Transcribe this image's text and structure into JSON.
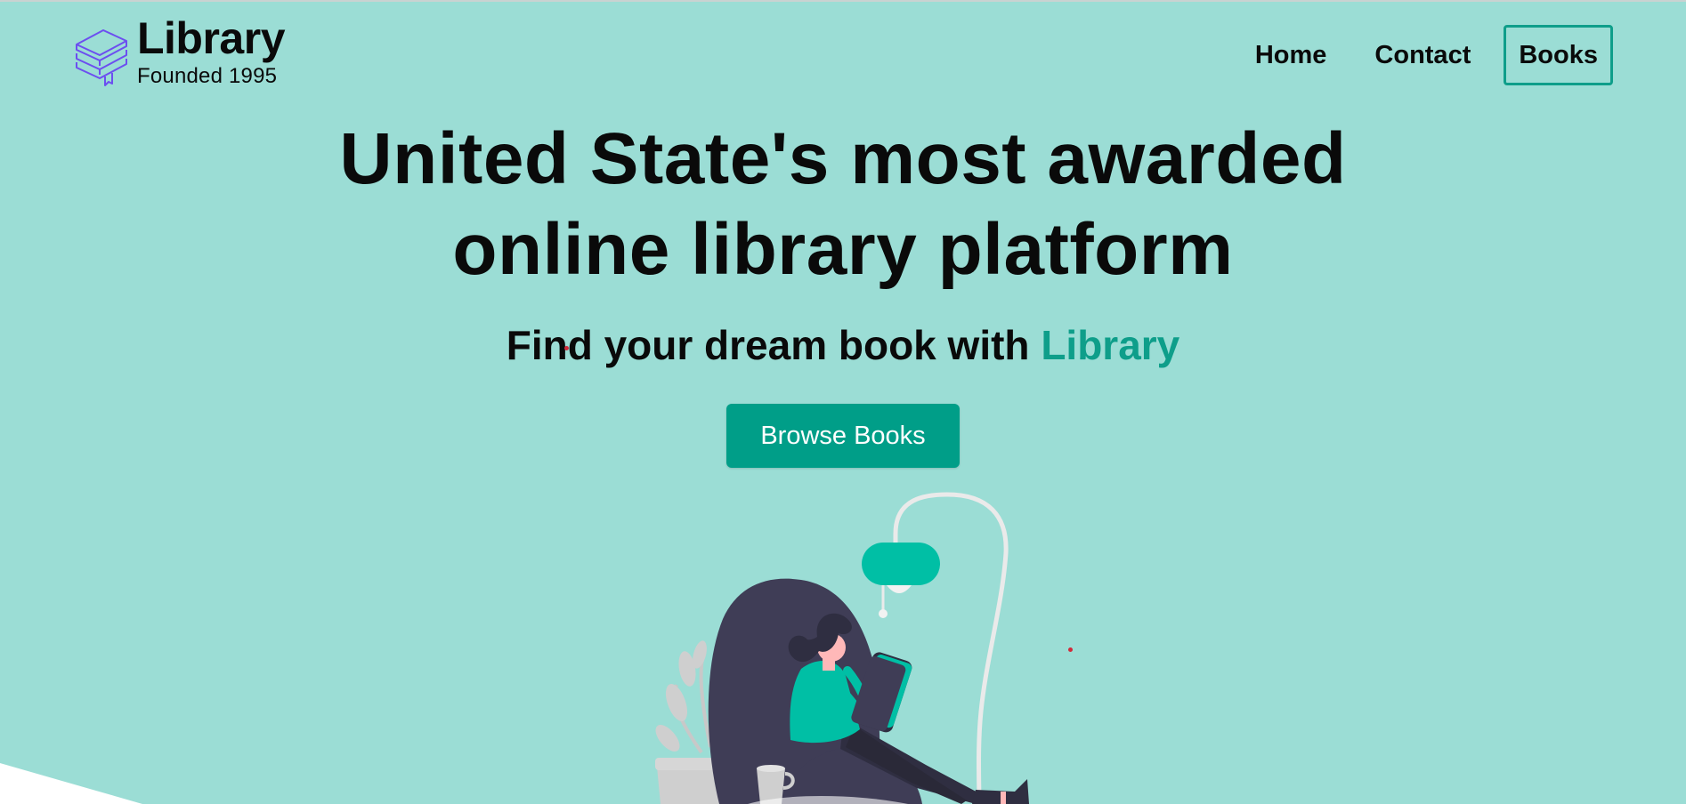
{
  "brand": {
    "name": "Library",
    "tagline": "Founded 1995",
    "logo_icon": "stacked-books-icon",
    "logo_color": "#6C4EF0"
  },
  "nav": {
    "items": [
      {
        "label": "Home",
        "active": false
      },
      {
        "label": "Contact",
        "active": false
      },
      {
        "label": "Books",
        "active": true
      }
    ],
    "active_border_color": "#0E9E8A"
  },
  "hero": {
    "headline_line1": "United State's most awarded",
    "headline_line2": "online library platform",
    "subline_prefix": "Find your dream book with",
    "subline_accent": "Library",
    "cta_label": "Browse Books"
  },
  "colors": {
    "background": "#9BDDD5",
    "accent": "#0E9E8A",
    "cta_background": "#009E88",
    "text": "#0a0a0a"
  },
  "illustration": {
    "icon": "woman-reading-in-beanbag-illustration"
  }
}
